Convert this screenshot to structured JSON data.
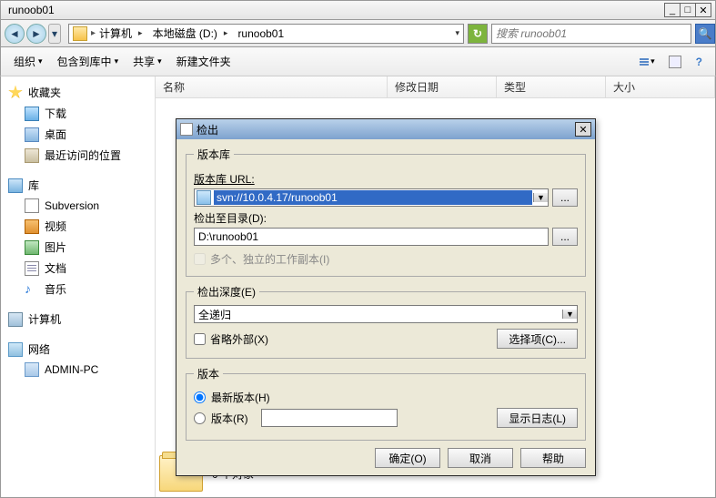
{
  "window": {
    "title": "runoob01"
  },
  "breadcrumb": {
    "root": "计算机",
    "drive": "本地磁盘 (D:)",
    "folder": "runoob01"
  },
  "search": {
    "placeholder": "搜索 runoob01"
  },
  "toolbar": {
    "organize": "组织",
    "include": "包含到库中",
    "share": "共享",
    "newfolder": "新建文件夹"
  },
  "columns": {
    "name": "名称",
    "modified": "修改日期",
    "type": "类型",
    "size": "大小"
  },
  "sidebar": {
    "favorites": "收藏夹",
    "downloads": "下载",
    "desktop": "桌面",
    "recent": "最近访问的位置",
    "libraries": "库",
    "subversion": "Subversion",
    "video": "视频",
    "pictures": "图片",
    "documents": "文档",
    "music": "音乐",
    "computer": "计算机",
    "network": "网络",
    "adminpc": "ADMIN-PC"
  },
  "status": {
    "count": "0 个对象"
  },
  "dialog": {
    "title": "检出",
    "repo_group": "版本库",
    "repo_url_label": "版本库 URL:",
    "repo_url_value": "svn://10.0.4.17/runoob01",
    "checkout_dir_label": "检出至目录(D):",
    "checkout_dir_value": "D:\\runoob01",
    "multi_checkbox": "多个、独立的工作副本(I)",
    "depth_label": "检出深度(E)",
    "depth_value": "全递归",
    "omit_ext": "省略外部(X)",
    "choose_items": "选择项(C)...",
    "rev_group": "版本",
    "rev_head": "最新版本(H)",
    "rev_rev": "版本(R)",
    "show_log": "显示日志(L)",
    "ok": "确定(O)",
    "cancel": "取消",
    "help": "帮助",
    "browse": "..."
  }
}
